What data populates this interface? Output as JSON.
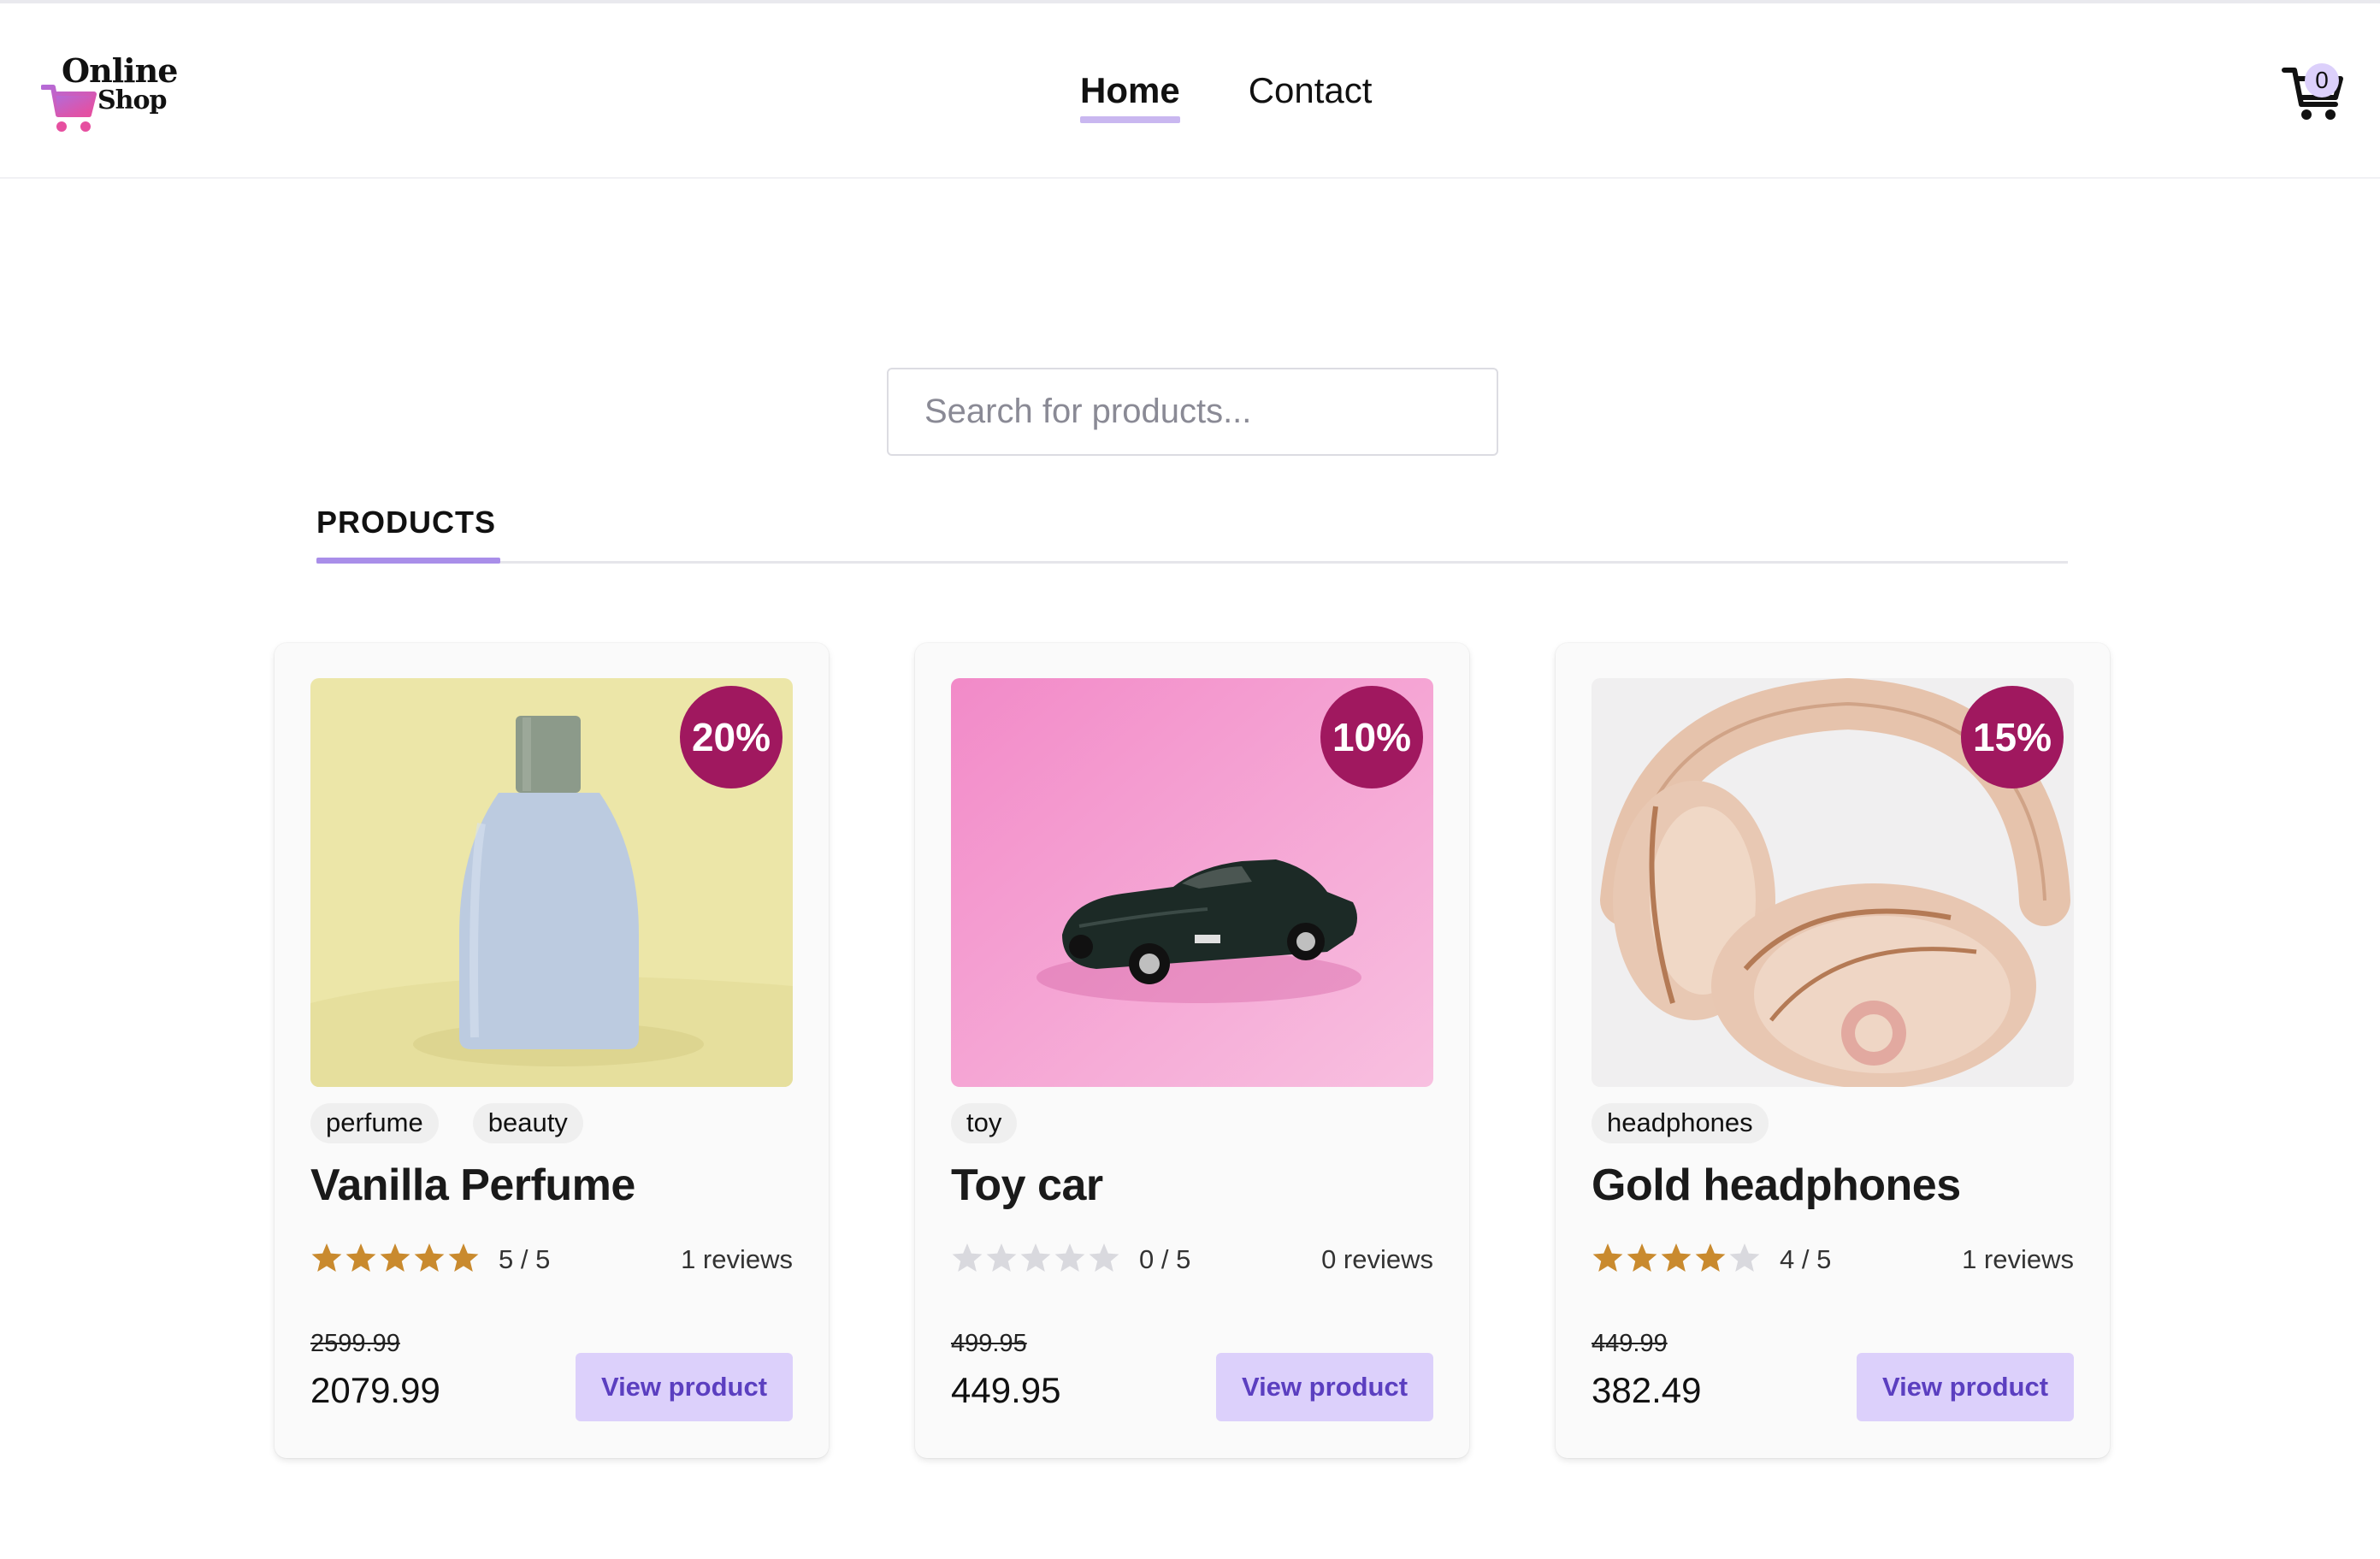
{
  "header": {
    "logo": {
      "line1": "Online",
      "line2": "Shop"
    },
    "nav": [
      {
        "label": "Home",
        "active": true
      },
      {
        "label": "Contact",
        "active": false
      }
    ],
    "cart": {
      "count": "0",
      "icon": "cart-icon"
    }
  },
  "search": {
    "placeholder": "Search for products...",
    "value": ""
  },
  "section": {
    "title": "PRODUCTS"
  },
  "colors": {
    "accent": "#a98ee9",
    "badge": "#a0185f",
    "button_bg": "#dcd0fb",
    "button_text": "#5b3fc0",
    "star": "#c98a2e",
    "star_empty": "#d9d9de"
  },
  "products": [
    {
      "discount": "20%",
      "tags": [
        "perfume",
        "beauty"
      ],
      "name": "Vanilla Perfume",
      "stars": 5,
      "rating": "5 / 5",
      "reviews": "1 reviews",
      "old_price": "2599.99",
      "price": "2079.99",
      "button": "View product"
    },
    {
      "discount": "10%",
      "tags": [
        "toy"
      ],
      "name": "Toy car",
      "stars": 0,
      "rating": "0 / 5",
      "reviews": "0 reviews",
      "old_price": "499.95",
      "price": "449.95",
      "button": "View product"
    },
    {
      "discount": "15%",
      "tags": [
        "headphones"
      ],
      "name": "Gold headphones",
      "stars": 4,
      "rating": "4 / 5",
      "reviews": "1 reviews",
      "old_price": "449.99",
      "price": "382.49",
      "button": "View product"
    }
  ]
}
